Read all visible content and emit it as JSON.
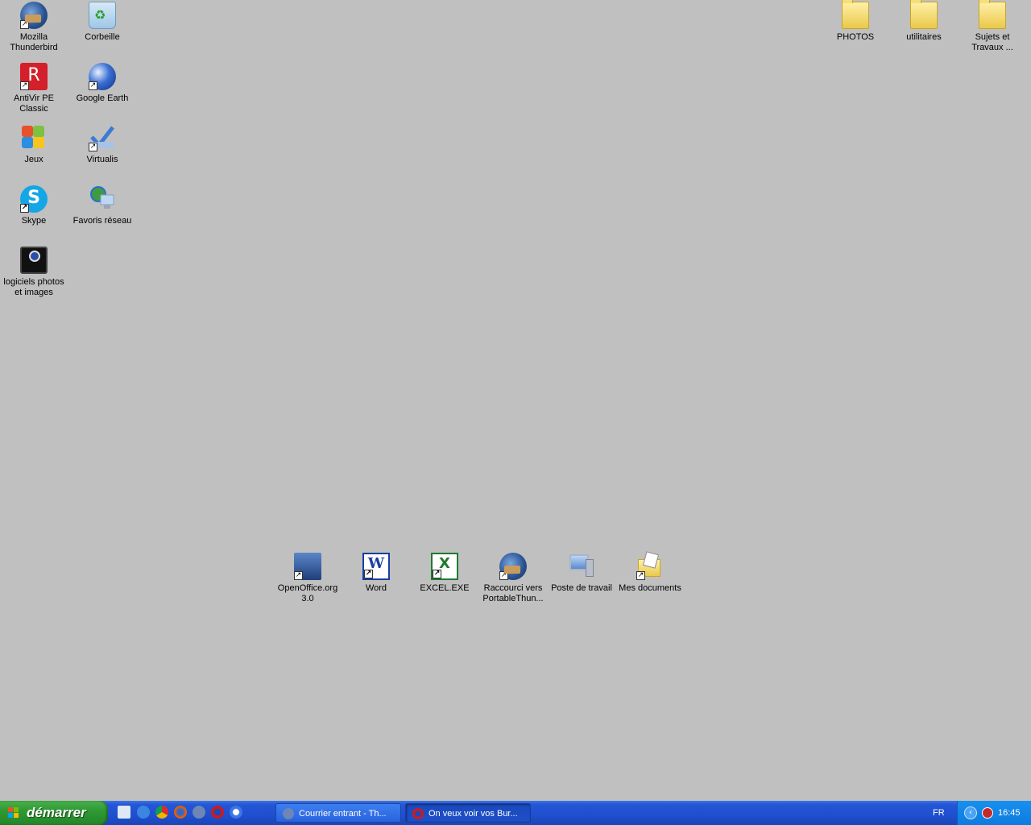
{
  "desktop": {
    "icons_left": [
      {
        "label": "Mozilla Thunderbird",
        "icon": "thunderbird-icon"
      },
      {
        "label": "Corbeille",
        "icon": "recycle-bin-icon"
      },
      {
        "label": "AntiVir PE Classic",
        "icon": "antivir-icon"
      },
      {
        "label": "Google Earth",
        "icon": "google-earth-icon"
      },
      {
        "label": "Jeux",
        "icon": "games-icon"
      },
      {
        "label": "Virtualis",
        "icon": "virtualis-icon"
      },
      {
        "label": "Skype",
        "icon": "skype-icon"
      },
      {
        "label": "Favoris réseau",
        "icon": "network-places-icon"
      },
      {
        "label": "logiciels photos et images",
        "icon": "camera-icon"
      }
    ],
    "icons_right": [
      {
        "label": "PHOTOS",
        "icon": "folder-icon"
      },
      {
        "label": "utilitaires",
        "icon": "folder-icon"
      },
      {
        "label": "Sujets et Travaux ...",
        "icon": "folder-icon"
      }
    ],
    "icons_bottom": [
      {
        "label": "OpenOffice.org 3.0",
        "icon": "openoffice-icon"
      },
      {
        "label": "Word",
        "icon": "word-icon"
      },
      {
        "label": "EXCEL.EXE",
        "icon": "excel-icon"
      },
      {
        "label": "Raccourci vers PortableThun...",
        "icon": "thunderbird-icon"
      },
      {
        "label": "Poste de travail",
        "icon": "my-computer-icon"
      },
      {
        "label": "Mes documents",
        "icon": "my-documents-icon"
      }
    ]
  },
  "taskbar": {
    "start_label": "démarrer",
    "quick_launch": [
      "show-desktop-icon",
      "internet-explorer-icon",
      "chrome-icon",
      "firefox-icon",
      "thunderbird-icon",
      "opera-icon",
      "media-player-icon"
    ],
    "tasks": [
      {
        "label": "Courrier entrant - Th...",
        "icon": "thunderbird-icon",
        "active": false
      },
      {
        "label": "On veux voir vos Bur...",
        "icon": "opera-icon",
        "active": true
      }
    ],
    "language": "FR",
    "clock": "16:45"
  }
}
